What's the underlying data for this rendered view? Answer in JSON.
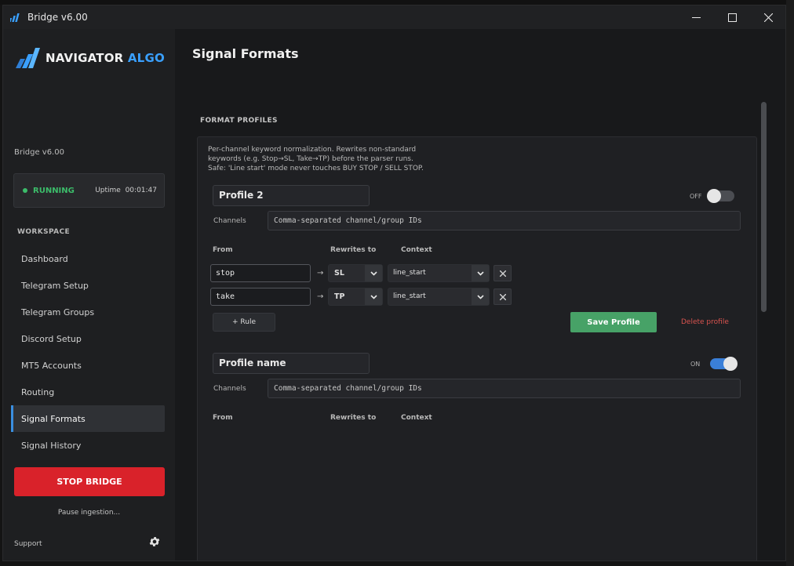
{
  "window": {
    "title": "Bridge v6.00"
  },
  "sidebar": {
    "logo": {
      "brand": "NAVIGATOR",
      "brand_accent": "ALGO"
    },
    "version": "Bridge v6.00",
    "status": {
      "label": "RUNNING",
      "uptime_label": "Uptime",
      "uptime": "00:01:47"
    },
    "workspace_label": "WORKSPACE",
    "items": [
      {
        "label": "Dashboard"
      },
      {
        "label": "Telegram Setup"
      },
      {
        "label": "Telegram Groups"
      },
      {
        "label": "Discord Setup"
      },
      {
        "label": "MT5 Accounts"
      },
      {
        "label": "Routing"
      },
      {
        "label": "Signal Formats",
        "active": true
      },
      {
        "label": "Signal History"
      }
    ],
    "stop_button": "STOP BRIDGE",
    "pause_link": "Pause ingestion...",
    "support_link": "Support"
  },
  "main": {
    "title": "Signal Formats",
    "section_label": "FORMAT PROFILES",
    "description": [
      "Per-channel keyword normalization. Rewrites non-standard",
      "keywords (e.g. Stop→SL, Take→TP) before the parser runs.",
      "Safe: 'Line start' mode never touches BUY STOP / SELL STOP."
    ],
    "column_headers": {
      "from": "From",
      "to": "Rewrites to",
      "context": "Context"
    },
    "profiles": [
      {
        "name": "Profile 2",
        "toggle_label": "OFF",
        "enabled": false,
        "channels_label": "Channels",
        "channels_placeholder": "Comma-separated channel/group IDs",
        "rules": [
          {
            "from": "stop",
            "arrow": "→",
            "to": "SL",
            "context": "line_start"
          },
          {
            "from": "take",
            "arrow": "→",
            "to": "TP",
            "context": "line_start"
          }
        ],
        "add_rule": "+ Rule",
        "save": "Save Profile",
        "delete": "Delete profile"
      },
      {
        "name": "Profile name",
        "toggle_label": "ON",
        "enabled": true,
        "channels_label": "Channels",
        "channels_placeholder": "Comma-separated channel/group IDs",
        "rules": []
      }
    ]
  },
  "colors": {
    "accent": "#3a8fe0",
    "running": "#3cbc6a",
    "stop": "#d9222a",
    "save": "#47a267",
    "delete": "#d9534f"
  }
}
